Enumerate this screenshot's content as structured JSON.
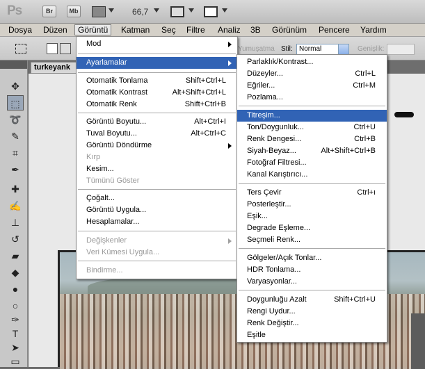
{
  "appbar": {
    "logo": "Ps",
    "bridge_label": "Br",
    "minibridge_label": "Mb",
    "zoom": "66,7"
  },
  "menubar": {
    "items": [
      "Dosya",
      "Düzen",
      "Görüntü",
      "Katman",
      "Seç",
      "Filtre",
      "Analiz",
      "3B",
      "Görünüm",
      "Pencere",
      "Yardım"
    ]
  },
  "options": {
    "smoothing_label": "Yumuşatma",
    "style_label": "Stil:",
    "style_value": "Normal",
    "width_label": "Genişlik:"
  },
  "document": {
    "tab_title": "turkeyank"
  },
  "image_menu": {
    "items": [
      {
        "label": "Mod",
        "shortcut": "",
        "submenu": true,
        "disabled": false
      },
      {
        "label": "Ayarlamalar",
        "shortcut": "",
        "submenu": true,
        "disabled": false,
        "highlighted": true
      },
      {
        "label": "Otomatik Tonlama",
        "shortcut": "Shift+Ctrl+L",
        "submenu": false,
        "disabled": false
      },
      {
        "label": "Otomatik Kontrast",
        "shortcut": "Alt+Shift+Ctrl+L",
        "submenu": false,
        "disabled": false
      },
      {
        "label": "Otomatik Renk",
        "shortcut": "Shift+Ctrl+B",
        "submenu": false,
        "disabled": false
      },
      {
        "label": "Görüntü Boyutu...",
        "shortcut": "Alt+Ctrl+I",
        "submenu": false,
        "disabled": false
      },
      {
        "label": "Tuval Boyutu...",
        "shortcut": "Alt+Ctrl+C",
        "submenu": false,
        "disabled": false
      },
      {
        "label": "Görüntü Döndürme",
        "shortcut": "",
        "submenu": true,
        "disabled": false
      },
      {
        "label": "Kırp",
        "shortcut": "",
        "submenu": false,
        "disabled": true
      },
      {
        "label": "Kesim...",
        "shortcut": "",
        "submenu": false,
        "disabled": false
      },
      {
        "label": "Tümünü Göster",
        "shortcut": "",
        "submenu": false,
        "disabled": true
      },
      {
        "label": "Çoğalt...",
        "shortcut": "",
        "submenu": false,
        "disabled": false
      },
      {
        "label": "Görüntü Uygula...",
        "shortcut": "",
        "submenu": false,
        "disabled": false
      },
      {
        "label": "Hesaplamalar...",
        "shortcut": "",
        "submenu": false,
        "disabled": false
      },
      {
        "label": "Değişkenler",
        "shortcut": "",
        "submenu": true,
        "disabled": true
      },
      {
        "label": "Veri Kümesi Uygula...",
        "shortcut": "",
        "submenu": false,
        "disabled": true
      },
      {
        "label": "Bindirme...",
        "shortcut": "",
        "submenu": false,
        "disabled": true
      }
    ]
  },
  "adjust_menu": {
    "items": [
      {
        "label": "Parlaklık/Kontrast...",
        "shortcut": ""
      },
      {
        "label": "Düzeyler...",
        "shortcut": "Ctrl+L"
      },
      {
        "label": "Eğriler...",
        "shortcut": "Ctrl+M"
      },
      {
        "label": "Pozlama...",
        "shortcut": ""
      },
      {
        "label": "Titreşim...",
        "shortcut": "",
        "highlighted": true
      },
      {
        "label": "Ton/Doygunluk...",
        "shortcut": "Ctrl+U"
      },
      {
        "label": "Renk Dengesi...",
        "shortcut": "Ctrl+B"
      },
      {
        "label": "Siyah-Beyaz...",
        "shortcut": "Alt+Shift+Ctrl+B"
      },
      {
        "label": "Fotoğraf Filtresi...",
        "shortcut": ""
      },
      {
        "label": "Kanal Karıştırıcı...",
        "shortcut": ""
      },
      {
        "label": "Ters Çevir",
        "shortcut": "Ctrl+ı"
      },
      {
        "label": "Posterleştir...",
        "shortcut": ""
      },
      {
        "label": "Eşik...",
        "shortcut": ""
      },
      {
        "label": "Degrade Eşleme...",
        "shortcut": ""
      },
      {
        "label": "Seçmeli Renk...",
        "shortcut": ""
      },
      {
        "label": "Gölgeler/Açık Tonlar...",
        "shortcut": ""
      },
      {
        "label": "HDR Tonlama...",
        "shortcut": ""
      },
      {
        "label": "Varyasyonlar...",
        "shortcut": ""
      },
      {
        "label": "Doygunluğu Azalt",
        "shortcut": "Shift+Ctrl+U"
      },
      {
        "label": "Rengi Uydur...",
        "shortcut": ""
      },
      {
        "label": "Renk Değiştir...",
        "shortcut": ""
      },
      {
        "label": "Eşitle",
        "shortcut": ""
      }
    ]
  },
  "colors": {
    "highlight": "#3163b5",
    "menu_bg": "#ffffff",
    "disabled_text": "#9a9a9a"
  }
}
